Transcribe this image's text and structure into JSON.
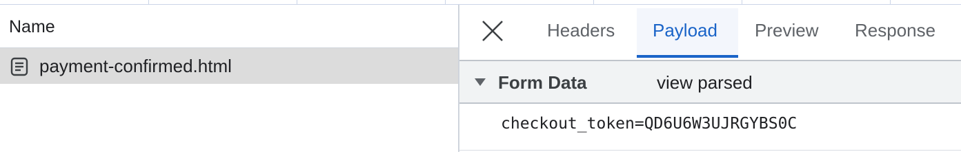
{
  "requests_panel": {
    "column_header": "Name",
    "rows": [
      {
        "name": "payment-confirmed.html",
        "icon": "document-icon",
        "selected": true
      }
    ]
  },
  "details_panel": {
    "close_icon": "close-icon",
    "tabs": [
      {
        "label": "Headers",
        "active": false
      },
      {
        "label": "Payload",
        "active": true
      },
      {
        "label": "Preview",
        "active": false
      },
      {
        "label": "Response",
        "active": false
      }
    ],
    "form_data": {
      "title": "Form Data",
      "toggle_label": "view parsed",
      "expanded": true,
      "raw": "checkout_token=QD6U6W3UJRGYBS0C"
    }
  },
  "colors": {
    "accent": "#1a64c8",
    "selected_row_bg": "#dcdcdc",
    "section_bg": "#f1f3f4"
  }
}
